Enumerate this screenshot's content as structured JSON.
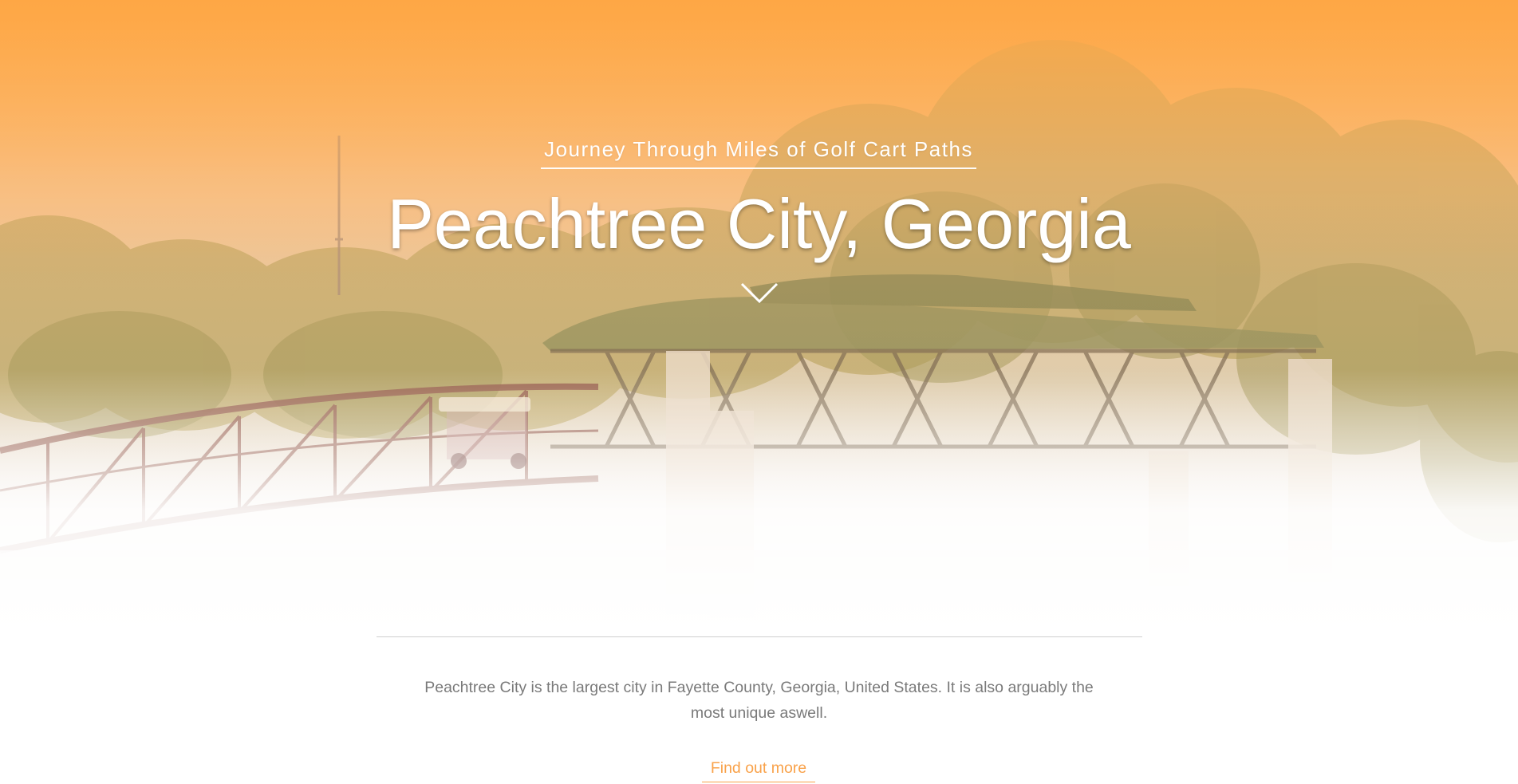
{
  "hero": {
    "subtitle": "Journey Through Miles of Golf Cart Paths",
    "title": "Peachtree City, Georgia",
    "scroll_icon": "chevron-down-icon",
    "background_image": "golf-cart-bridge-photo"
  },
  "intro": {
    "text": "Peachtree City is the largest city in Fayette County, Georgia, United States. It is also arguably the most unique aswell."
  },
  "cta": {
    "label": "Find out more"
  },
  "colors": {
    "accent": "#f9a24a",
    "hero_top": "#fea745",
    "body_text": "#7a7a7a",
    "divider": "#cfcfcf"
  }
}
